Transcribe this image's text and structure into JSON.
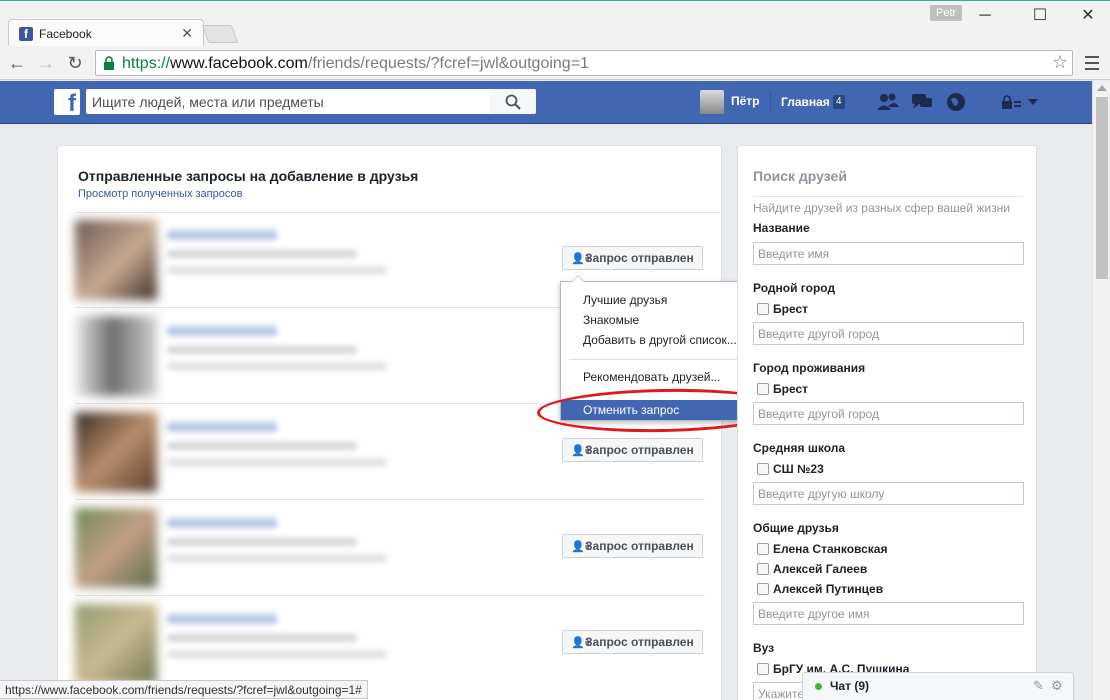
{
  "browser": {
    "tab_title": "Facebook",
    "profile_name": "Petr",
    "url_scheme": "https://",
    "url_host": "www.facebook.com",
    "url_path": "/friends/requests/?fcref=jwl&outgoing=1",
    "status_url": "https://www.facebook.com/friends/requests/?fcref=jwl&outgoing=1#"
  },
  "fb": {
    "search_placeholder": "Ищите людей, места или предметы",
    "user_name": "Пётр",
    "home_label": "Главная",
    "home_count": "4",
    "colors": {
      "brand": "#4267b2",
      "link": "#365899"
    }
  },
  "main": {
    "title": "Отправленные запросы на добавление в друзья",
    "received_link": "Просмотр полученных запросов",
    "request_button": "Запрос отправлен"
  },
  "dropdown": {
    "items": [
      "Лучшие друзья",
      "Знакомые",
      "Добавить в другой список...",
      "Рекомендовать друзей...",
      "Отменить запрос"
    ]
  },
  "sidebar": {
    "title": "Поиск друзей",
    "subtitle": "Найдите друзей из разных сфер вашей жизни",
    "name_label": "Название",
    "name_placeholder": "Введите имя",
    "hometown_label": "Родной город",
    "hometown_option": "Брест",
    "hometown_placeholder": "Введите другой город",
    "current_city_label": "Город проживания",
    "current_city_option": "Брест",
    "current_city_placeholder": "Введите другой город",
    "school_label": "Средняя школа",
    "school_option": "СШ №23",
    "school_placeholder": "Введите другую школу",
    "mutual_label": "Общие друзья",
    "mutual_options": [
      "Елена Станковская",
      "Алексей Галеев",
      "Алексей Путинцев"
    ],
    "mutual_placeholder": "Введите другое имя",
    "university_label": "Вуз",
    "university_option": "БрГУ им. А.С. Пушкина",
    "university_placeholder": "Укажите"
  },
  "chat": {
    "label": "Чат (9)"
  }
}
